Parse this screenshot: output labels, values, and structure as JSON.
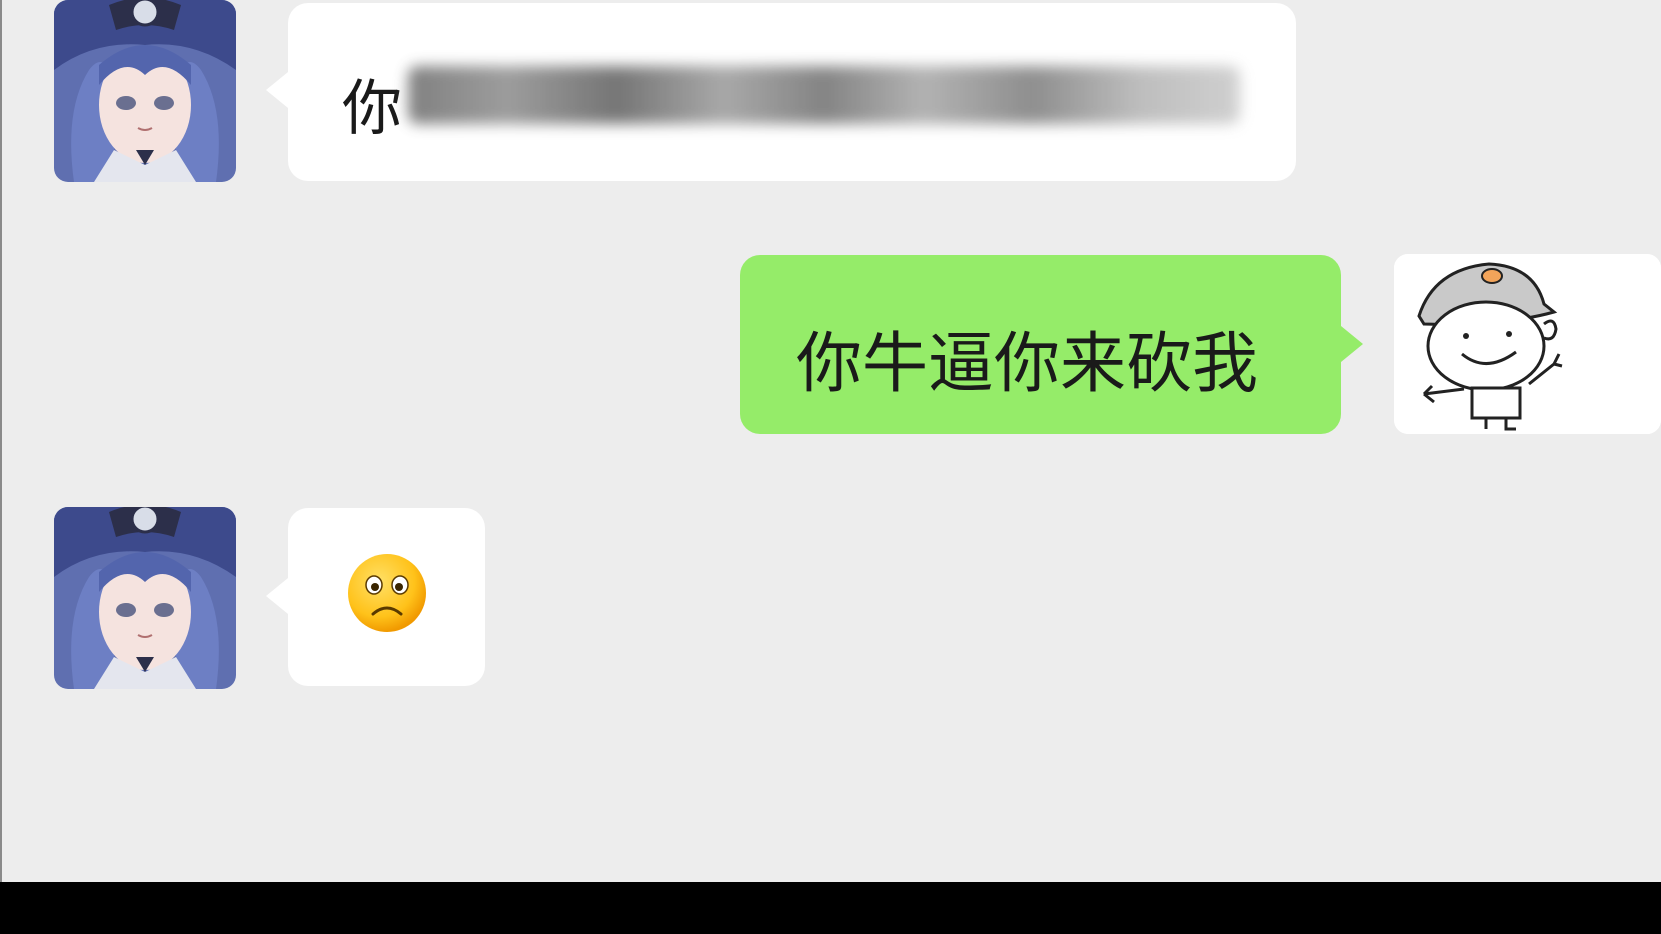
{
  "messages": [
    {
      "side": "received",
      "sender_avatar": "anime-character-avatar",
      "text_visible": "你"
    },
    {
      "side": "sent",
      "sender_avatar": "cartoon-doodle-avatar",
      "text": "你牛逼你来砍我"
    },
    {
      "side": "received",
      "sender_avatar": "anime-character-avatar",
      "emoji": "☹️"
    }
  ],
  "colors": {
    "chat_background": "#ededed",
    "received_bubble": "#ffffff",
    "sent_bubble": "#95ec69"
  }
}
